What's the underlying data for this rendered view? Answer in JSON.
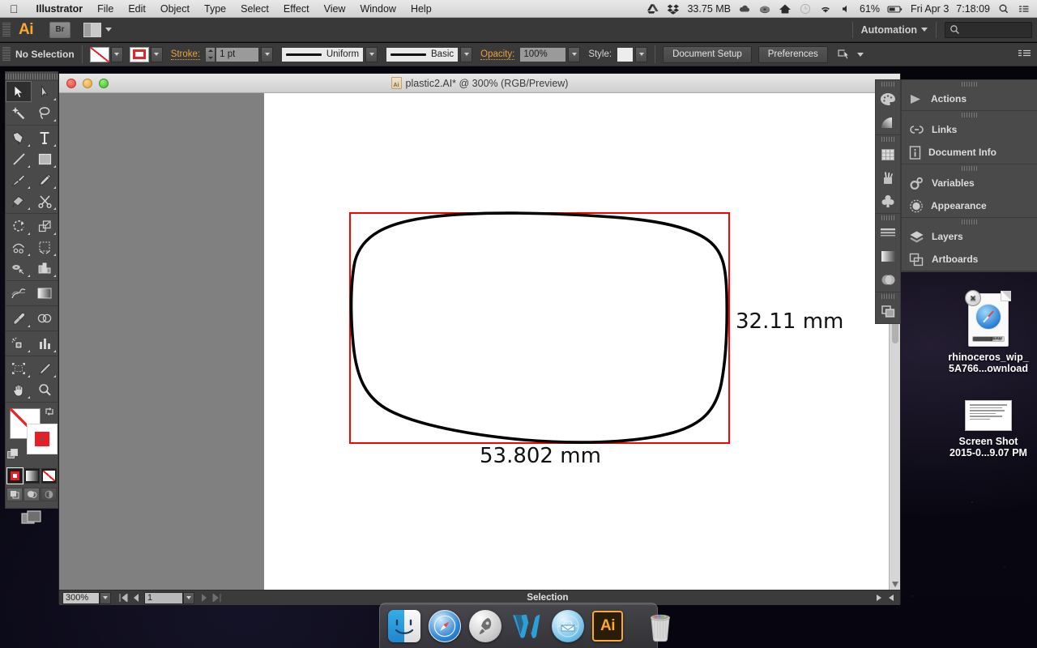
{
  "menubar": {
    "apple_icon": "apple-icon",
    "items": [
      "Illustrator",
      "File",
      "Edit",
      "Object",
      "Type",
      "Select",
      "Effect",
      "View",
      "Window",
      "Help"
    ],
    "status": {
      "drive_icon": "google-drive-icon",
      "dropbox_icon": "dropbox-icon",
      "memory": "33.75 MB",
      "cloud_icon": "cloud-icon",
      "disc_icon": "disc-icon",
      "home_icon": "home-icon",
      "clock_icon": "clock-icon",
      "wifi_icon": "wifi-icon",
      "volume_icon": "volume-icon",
      "battery_percent": "61%",
      "battery_icon": "battery-icon",
      "date": "Fri Apr 3",
      "time": "7:18:09",
      "search_icon": "spotlight-search-icon",
      "notification_icon": "notification-center-icon"
    }
  },
  "appbar": {
    "logo": "Ai",
    "bridge_label": "Br",
    "arrange_icon": "arrange-documents-icon",
    "workspace": "Automation",
    "search_icon": "search-icon",
    "search_value": ""
  },
  "controlbar": {
    "selection_state": "No Selection",
    "fill_icon": "fill-none-swatch",
    "stroke_icon": "stroke-color-swatch",
    "stroke_label": "Stroke:",
    "stroke_weight": "1 pt",
    "stroke_profile": "Uniform",
    "brush": "Basic",
    "opacity_label": "Opacity:",
    "opacity_value": "100%",
    "style_label": "Style:",
    "document_setup": "Document Setup",
    "preferences": "Preferences",
    "select_similar_icon": "select-similar-objects-icon",
    "panel_menu_icon": "panel-menu-icon"
  },
  "toolbox": {
    "tools": [
      "selection-tool",
      "direct-selection-tool",
      "magic-wand-tool",
      "lasso-tool",
      "pen-tool",
      "type-tool",
      "line-segment-tool",
      "rectangle-tool",
      "paintbrush-tool",
      "pencil-tool",
      "blob-brush-tool",
      "scissors-tool",
      "rotate-tool",
      "scale-tool",
      "width-tool",
      "free-transform-tool",
      "perspective-grid-tool",
      "graph-tool",
      "mesh-tool",
      "gradient-tool",
      "eyedropper-tool",
      "blend-tool",
      "symbol-sprayer-tool",
      "column-graph-tool",
      "artboard-tool",
      "slice-tool",
      "hand-tool",
      "zoom-tool"
    ],
    "active_tool": "selection-tool",
    "fill_swatch": "none",
    "stroke_swatch": "#ed1c24",
    "color_modes": [
      "color-button",
      "gradient-button",
      "none-button"
    ],
    "draw_modes": [
      "draw-normal-button",
      "draw-behind-button",
      "draw-inside-button"
    ],
    "screen_mode": "change-screen-mode-button"
  },
  "document": {
    "title": "plastic2.AI* @ 300% (RGB/Preview)",
    "file_icon": "ai-document-icon",
    "window_controls": [
      "close-button",
      "minimize-button",
      "zoom-button"
    ],
    "dimension_width": "53.802 mm",
    "dimension_height": "32.11 mm",
    "bounding_box_color": "#ff0000",
    "path_color": "#000000"
  },
  "statusbar": {
    "zoom_level": "300%",
    "artboard_number": "1",
    "status_text": "Selection",
    "first_icon": "first-artboard-icon",
    "prev_icon": "previous-artboard-icon",
    "next_icon": "next-artboard-icon",
    "last_icon": "last-artboard-icon"
  },
  "icon_dock": {
    "groups": [
      [
        "color-panel-icon",
        "gradient-panel-icon"
      ],
      [
        "swatches-panel-icon",
        "brushes-panel-icon",
        "symbols-panel-icon"
      ],
      [
        "stroke-panel-icon",
        "gradient2-panel-icon",
        "transparency-panel-icon"
      ],
      [
        "pathfinder-panel-icon"
      ]
    ]
  },
  "panels": {
    "groups": [
      {
        "items": [
          {
            "icon": "actions-panel-icon",
            "label": "Actions"
          }
        ]
      },
      {
        "items": [
          {
            "icon": "links-panel-icon",
            "label": "Links"
          },
          {
            "icon": "document-info-panel-icon",
            "label": "Document Info"
          }
        ]
      },
      {
        "items": [
          {
            "icon": "variables-panel-icon",
            "label": "Variables"
          },
          {
            "icon": "appearance-panel-icon",
            "label": "Appearance"
          }
        ]
      },
      {
        "items": [
          {
            "icon": "layers-panel-icon",
            "label": "Layers"
          },
          {
            "icon": "artboards-panel-icon",
            "label": "Artboards"
          }
        ]
      }
    ]
  },
  "desktop_icons": [
    {
      "name": "rhinoceros-download-icon",
      "label_line1": "rhinoceros_wip_",
      "label_line2": "5A766...ownload",
      "badge": "cancel-download-badge",
      "app_icon": "safari-icon",
      "progress_label": "BAD"
    },
    {
      "name": "screenshot-file-icon",
      "label_line1": "Screen Shot",
      "label_line2": "2015-0...9.07 PM"
    }
  ],
  "dock": {
    "items": [
      {
        "name": "finder-dock-icon",
        "label": "Finder",
        "running": false
      },
      {
        "name": "safari-dock-icon",
        "label": "Safari",
        "running": false
      },
      {
        "name": "launchpad-dock-icon",
        "label": "Launchpad",
        "running": false
      },
      {
        "name": "word-dock-icon",
        "label": "Microsoft Word",
        "running": false
      },
      {
        "name": "mailbox-dock-icon",
        "label": "Mailbox",
        "running": false
      },
      {
        "name": "illustrator-dock-icon",
        "label": "Ai",
        "running": true
      }
    ],
    "trash": {
      "name": "trash-dock-icon",
      "label": "Trash"
    }
  }
}
